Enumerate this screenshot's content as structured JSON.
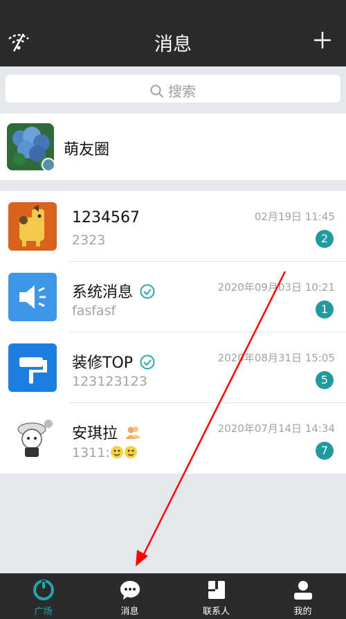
{
  "header": {
    "title": "消息"
  },
  "search": {
    "placeholder": "搜索"
  },
  "moments": {
    "label": "萌友圈"
  },
  "conversations": [
    {
      "name": "1234567",
      "preview": "2323",
      "time": "02月19日 11:45",
      "badge": "2"
    },
    {
      "name": "系统消息",
      "preview": "fasfasf",
      "time": "2020年09月03日 10:21",
      "badge": "1"
    },
    {
      "name": "装修TOP",
      "preview": "123123123",
      "time": "2020年08月31日 15:05",
      "badge": "5"
    },
    {
      "name": "安琪拉",
      "preview": "1311:",
      "time": "2020年07月14日 14:34",
      "badge": "7"
    }
  ],
  "nav": {
    "items": [
      {
        "label": "广场",
        "active": true
      },
      {
        "label": "消息"
      },
      {
        "label": "联系人"
      },
      {
        "label": "我的"
      }
    ]
  },
  "colors": {
    "header_bg": "#2b2b2d",
    "accent": "#1f9aa0",
    "annotation_arrow": "#ff0000"
  },
  "icons": [
    "wifi-off-icon",
    "plus-icon",
    "search-icon",
    "verified-check-icon",
    "group-icon",
    "chat-bubble-icon",
    "contacts-icon",
    "user-icon",
    "plaza-icon"
  ]
}
